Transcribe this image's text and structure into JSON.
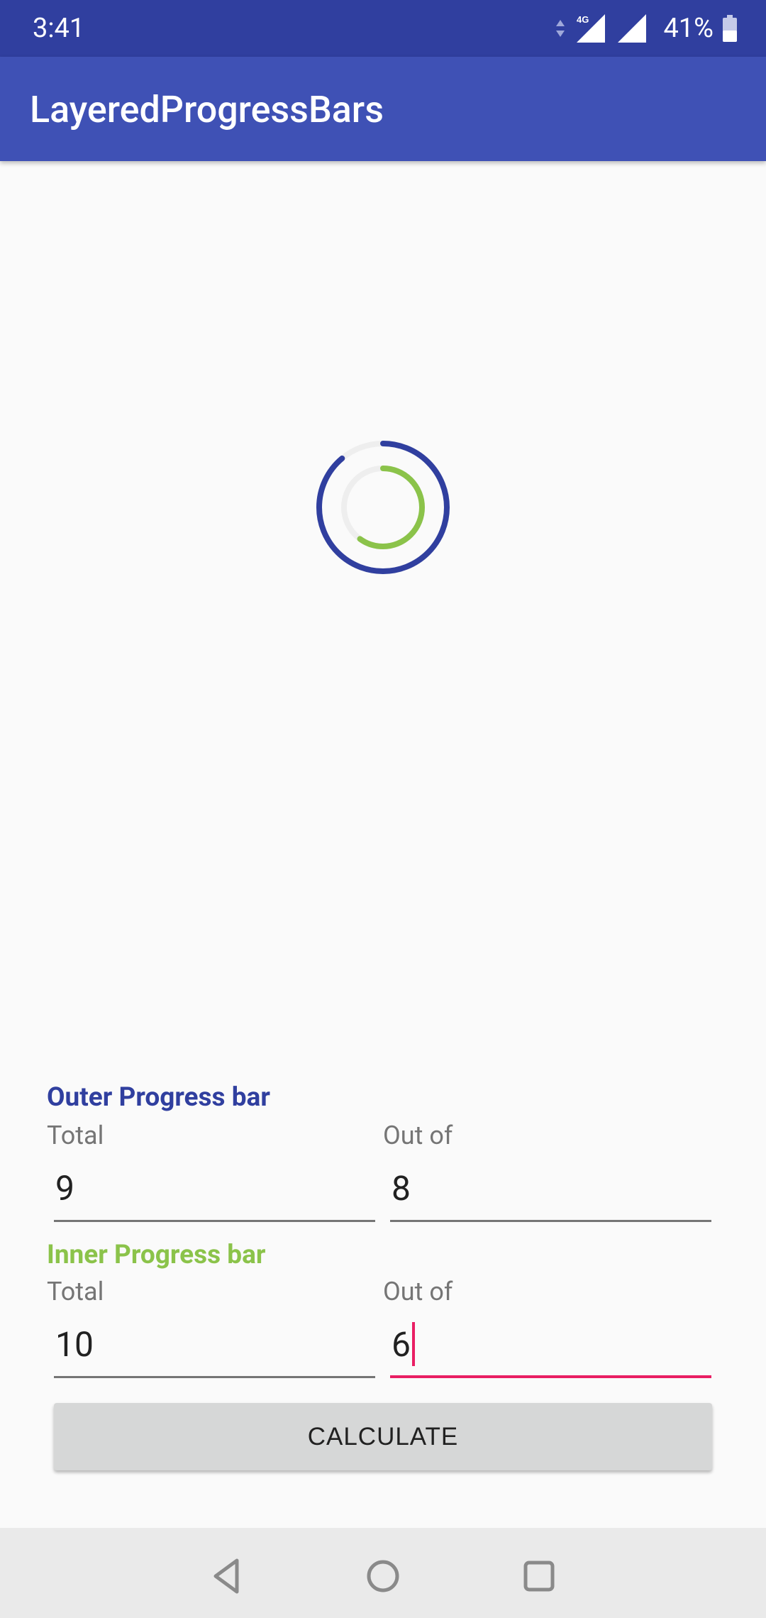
{
  "status": {
    "time": "3:41",
    "network_label": "4G",
    "battery_percent": "41%"
  },
  "app_bar": {
    "title": "LayeredProgressBars"
  },
  "progress": {
    "outer_value": 8,
    "outer_total": 9,
    "inner_value": 6,
    "inner_total": 10,
    "outer_color": "#303f9f",
    "inner_color": "#8bc34a",
    "track_color": "#eeeeee"
  },
  "outer_section": {
    "label": "Outer Progress bar",
    "total_caption": "Total",
    "outof_caption": "Out of",
    "total_value": "9",
    "outof_value": "8"
  },
  "inner_section": {
    "label": "Inner Progress bar",
    "total_caption": "Total",
    "outof_caption": "Out of",
    "total_value": "10",
    "outof_value": "6"
  },
  "button": {
    "label": "CALCULATE"
  },
  "nav": {
    "back_icon": "back-triangle-icon",
    "home_icon": "home-circle-icon",
    "recents_icon": "recents-square-icon"
  }
}
